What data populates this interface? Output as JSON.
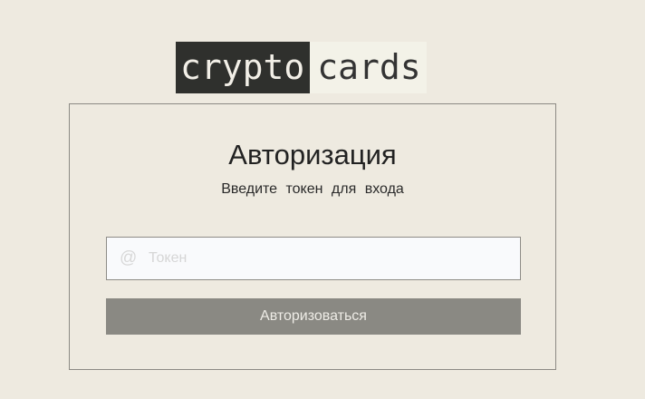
{
  "logo": {
    "part1": "crypto",
    "part2": "cards"
  },
  "auth": {
    "title": "Авторизация",
    "subtitle": "Введите токен для входа",
    "token_icon": "@",
    "token_placeholder": "Токен",
    "token_value": "",
    "submit_label": "Авторизоваться"
  },
  "colors": {
    "background": "#eeeae0",
    "logo_dark": "#2f302d",
    "button": "#8a8983",
    "input_bg": "#f9fafc"
  },
  "icons": {
    "token_field": "at-icon"
  }
}
